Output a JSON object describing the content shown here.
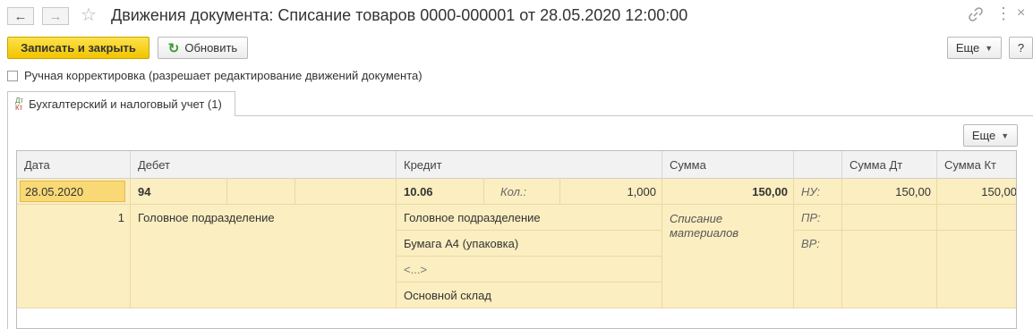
{
  "window": {
    "title": "Движения документа: Списание товаров 0000-000001 от 28.05.2020 12:00:00"
  },
  "icons": {
    "back": "arrow-left-icon",
    "forward": "arrow-right-icon",
    "favorite": "star-icon",
    "link": "link-icon",
    "menu": "more-vertical-icon",
    "close": "close-icon"
  },
  "toolbar": {
    "save_close_label": "Записать и закрыть",
    "refresh_label": "Обновить",
    "more_label": "Еще",
    "help_label": "?"
  },
  "manual_correction": {
    "label": "Ручная корректировка (разрешает редактирование движений документа)",
    "checked": false
  },
  "tabs": [
    {
      "label": "Бухгалтерский и налоговый учет (1)",
      "icon": "dt-kt-icon",
      "icon_top": "Дт",
      "icon_bottom": "Кт"
    }
  ],
  "table": {
    "more_label": "Еще",
    "headers": {
      "date": "Дата",
      "debit": "Дебет",
      "credit": "Кредит",
      "sum": "Сумма",
      "sum_dt": "Сумма Дт",
      "sum_kt": "Сумма Кт"
    },
    "row": {
      "date": "28.05.2020",
      "line_no": "1",
      "debit_account": "94",
      "debit_subconto1": "Головное подразделение",
      "credit_account": "10.06",
      "qty_label": "Кол.:",
      "qty_value": "1,000",
      "credit_subconto1": "Головное подразделение",
      "credit_subconto2": "Бумага А4 (упаковка)",
      "credit_subconto3": "<...>",
      "credit_subconto4": "Основной склад",
      "sum": "150,00",
      "content": "Списание материалов",
      "nu_label": "НУ:",
      "pr_label": "ПР:",
      "vr_label": "ВР:",
      "sum_dt_nu": "150,00",
      "sum_kt_nu": "150,00"
    }
  }
}
